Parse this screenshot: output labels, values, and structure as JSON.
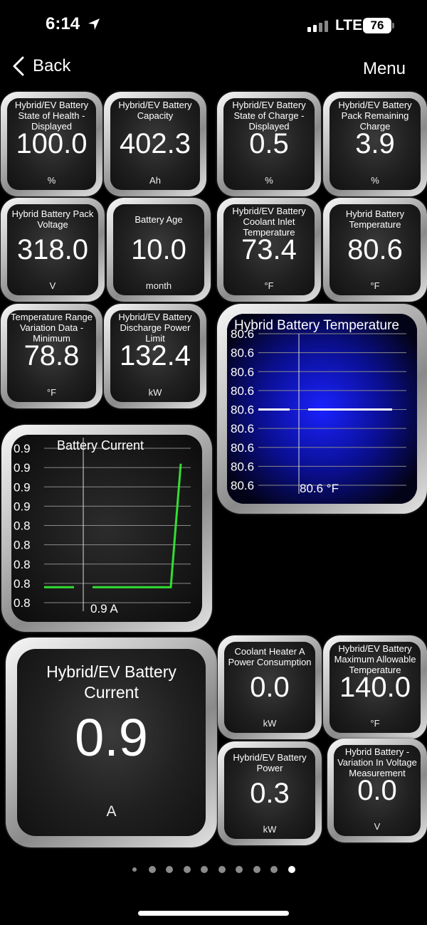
{
  "status": {
    "time": "6:14",
    "network": "LTE",
    "battery": "76"
  },
  "nav": {
    "back_label": "Back",
    "menu_label": "Menu"
  },
  "gauges": [
    {
      "label": "Hybrid/EV Battery State of Health - Displayed",
      "value": "100.0",
      "unit": "%"
    },
    {
      "label": "Hybrid/EV Battery Capacity",
      "value": "402.3",
      "unit": "Ah"
    },
    {
      "label": "Hybrid/EV Battery State of Charge - Displayed",
      "value": "0.5",
      "unit": "%"
    },
    {
      "label": "Hybrid/EV Battery Pack Remaining Charge",
      "value": "3.9",
      "unit": "%"
    },
    {
      "label": "Hybrid Battery Pack Voltage",
      "value": "318.0",
      "unit": "V"
    },
    {
      "label": "Battery Age",
      "value": "10.0",
      "unit": "month"
    },
    {
      "label": "Hybrid/EV Battery Coolant Inlet Temperature",
      "value": "73.4",
      "unit": "°F"
    },
    {
      "label": "Hybrid Battery Temperature",
      "value": "80.6",
      "unit": "°F"
    },
    {
      "label": "Temperature Range Variation Data - Minimum",
      "value": "78.8",
      "unit": "°F"
    },
    {
      "label": "Hybrid/EV Battery Discharge Power Limit",
      "value": "132.4",
      "unit": "kW"
    },
    {
      "label": "Coolant Heater A Power Consumption",
      "value": "0.0",
      "unit": "kW"
    },
    {
      "label": "Hybrid/EV Battery Maximum Allowable Temperature",
      "value": "140.0",
      "unit": "°F"
    },
    {
      "label": "Hybrid/EV Battery Power",
      "value": "0.3",
      "unit": "kW"
    },
    {
      "label": "Hybrid Battery - Variation In Voltage Measurement",
      "value": "0.0",
      "unit": "V"
    }
  ],
  "big_gauge": {
    "label": "Hybrid/EV Battery Current",
    "value": "0.9",
    "unit": "A"
  },
  "chart_data": [
    {
      "type": "line",
      "title": "Hybrid Battery Temperature",
      "y_tick_labels": [
        "80.6",
        "80.6",
        "80.6",
        "80.6",
        "80.6",
        "80.6",
        "80.6",
        "80.6",
        "80.6"
      ],
      "current_value": "80.6 °F",
      "series_color": "#ffffff",
      "values": [
        80.6,
        80.6,
        80.6,
        80.6
      ],
      "ylim": [
        80.55,
        80.65
      ]
    },
    {
      "type": "line",
      "title": "Battery Current",
      "y_tick_labels": [
        "0.9",
        "0.9",
        "0.9",
        "0.9",
        "0.8",
        "0.8",
        "0.8",
        "0.8",
        "0.8"
      ],
      "current_value": "0.9 A",
      "series_color": "#33dd33",
      "values": [
        0.77,
        0.77,
        0.77,
        0.77,
        0.77,
        0.93
      ],
      "ylim": [
        0.75,
        0.95
      ]
    }
  ],
  "pager": {
    "pages": 10,
    "current": 10
  }
}
